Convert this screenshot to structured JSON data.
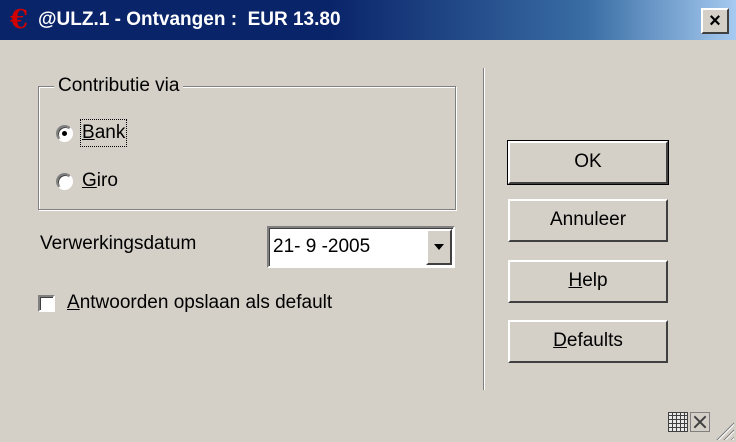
{
  "window": {
    "title": "@ULZ.1 - Ontvangen :  EUR 13.80",
    "icon": "euro-icon",
    "close_label": "×"
  },
  "group": {
    "label": "Contributie via",
    "options": [
      {
        "pre": "",
        "mnemonic": "B",
        "post": "ank",
        "checked": true
      },
      {
        "pre": "",
        "mnemonic": "G",
        "post": "iro",
        "checked": false
      }
    ]
  },
  "date_field": {
    "label": "Verwerkingsdatum",
    "value": "21- 9 -2005"
  },
  "save_default": {
    "mnemonic": "A",
    "post": "ntwoorden opslaan als default",
    "checked": false
  },
  "buttons": {
    "ok": {
      "pre": "OK",
      "mnemonic": "",
      "post": ""
    },
    "cancel": {
      "pre": "Annuleer",
      "mnemonic": "",
      "post": ""
    },
    "help": {
      "pre": "",
      "mnemonic": "H",
      "post": "elp"
    },
    "defaults": {
      "pre": "",
      "mnemonic": "D",
      "post": "efaults"
    }
  },
  "status_bar": {
    "icons": [
      "keyboard-icon",
      "expand-icon",
      "resize-grip-icon"
    ]
  },
  "colors": {
    "title_start": "#0a246a",
    "title_end": "#a6caf0",
    "face": "#d4d0c8"
  }
}
